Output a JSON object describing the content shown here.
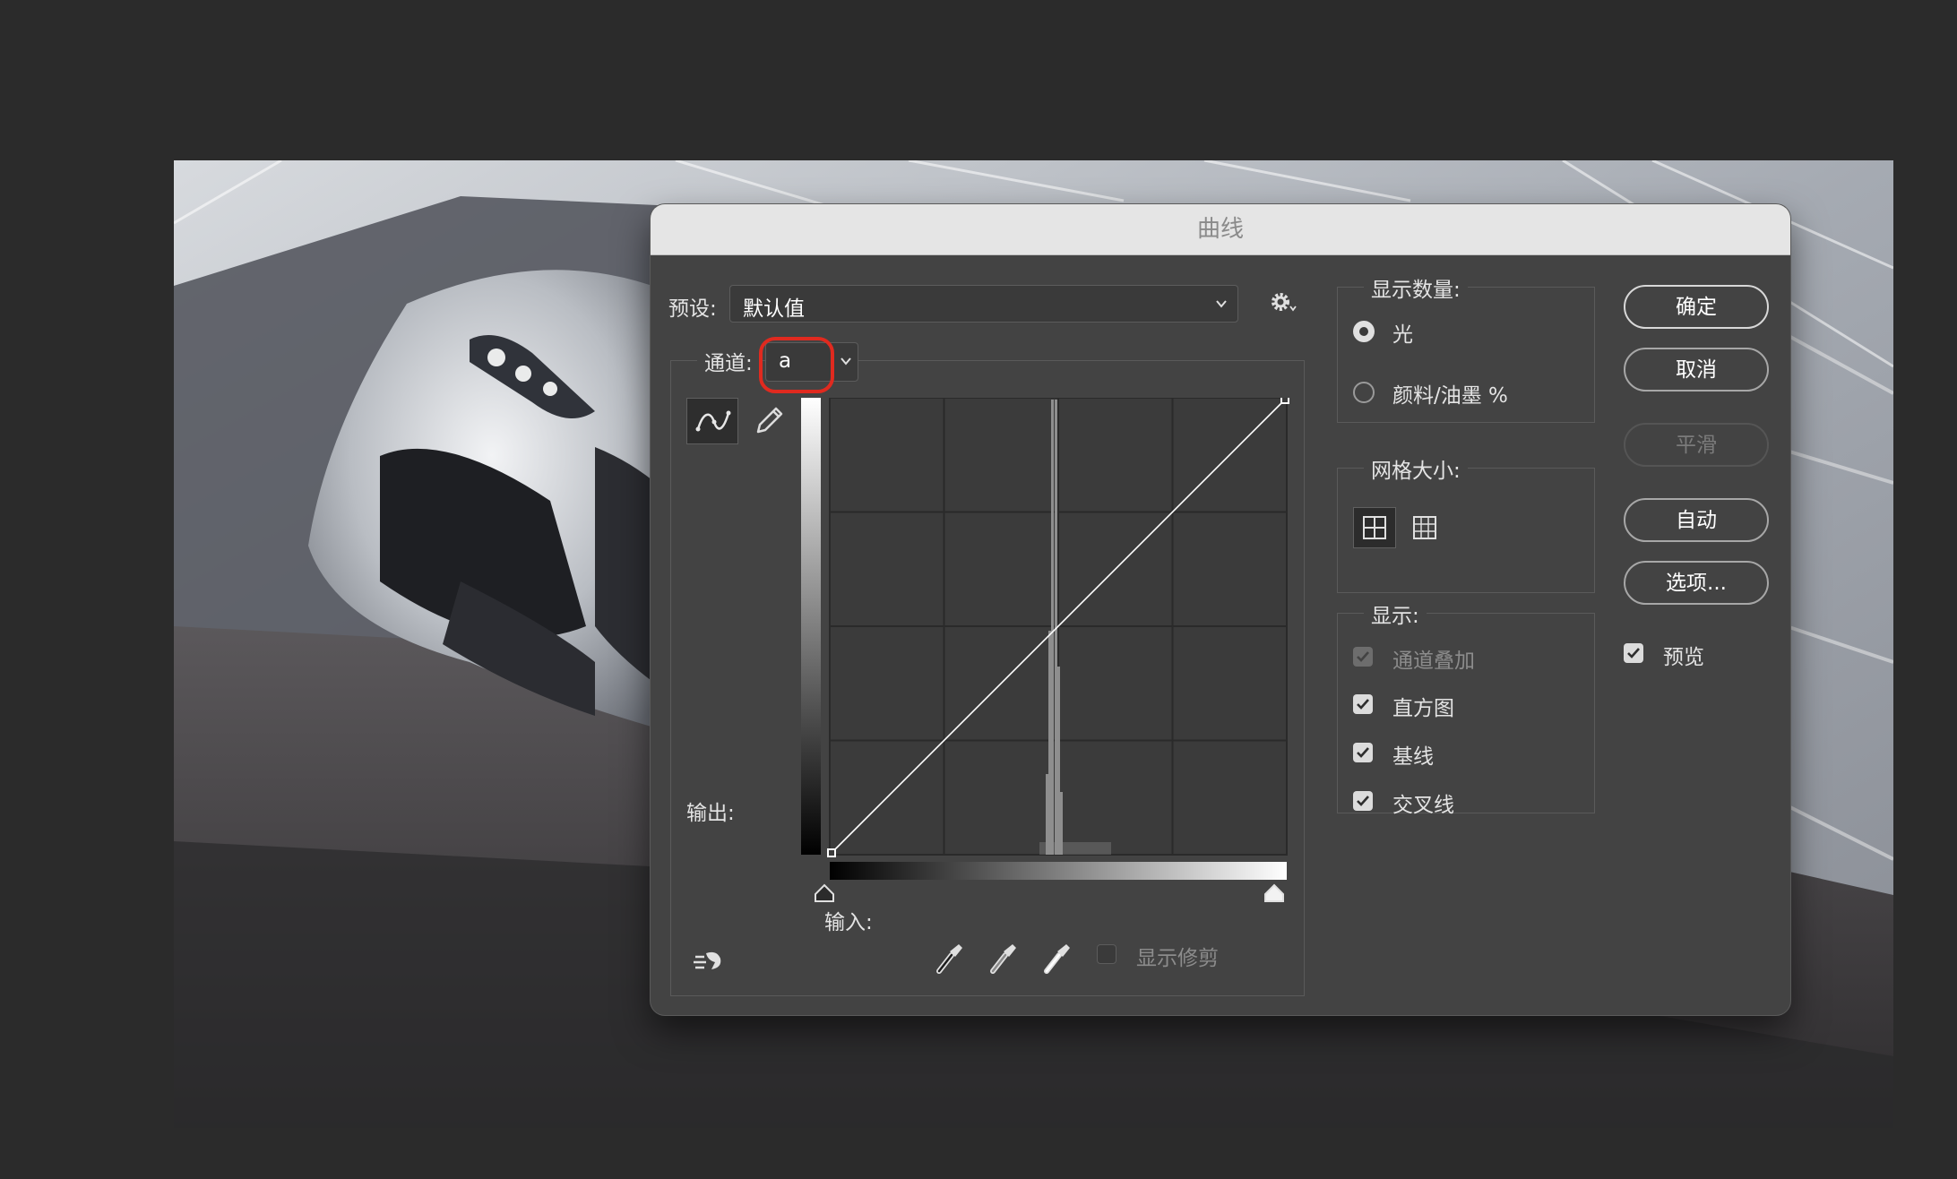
{
  "dialog": {
    "title": "曲线",
    "preset": {
      "label": "预设:",
      "value": "默认值"
    },
    "channel": {
      "label": "通道:",
      "value": "a"
    },
    "output_label": "输出:",
    "input_label": "输入:",
    "show_clipping": {
      "label": "显示修剪",
      "checked": false
    }
  },
  "display_amount": {
    "title": "显示数量:",
    "options": [
      {
        "label": "光",
        "selected": true
      },
      {
        "label": "颜料/油墨 %",
        "selected": false
      }
    ]
  },
  "grid_size": {
    "title": "网格大小:",
    "selected": "4x4"
  },
  "show": {
    "title": "显示:",
    "items": [
      {
        "label": "通道叠加",
        "checked": true,
        "enabled": false
      },
      {
        "label": "直方图",
        "checked": true,
        "enabled": true
      },
      {
        "label": "基线",
        "checked": true,
        "enabled": true
      },
      {
        "label": "交叉线",
        "checked": true,
        "enabled": true
      }
    ]
  },
  "buttons": {
    "ok": "确定",
    "cancel": "取消",
    "smooth": "平滑",
    "auto": "自动",
    "options": "选项..."
  },
  "preview": {
    "label": "预览",
    "checked": true
  },
  "curve": {
    "points": [
      [
        0,
        0
      ],
      [
        255,
        255
      ]
    ],
    "histogram_peak_input": 124
  },
  "colors": {
    "dialog_bg": "#434343",
    "titlebar_bg": "#e5e5e5",
    "highlight": "#e02a1f"
  },
  "icons": [
    "curve-tool-icon",
    "pencil-icon",
    "settings-gear-icon",
    "grid-4x4-icon",
    "grid-10x10-icon",
    "on-image-adjust-icon",
    "black-eyedropper-icon",
    "gray-eyedropper-icon",
    "white-eyedropper-icon"
  ]
}
